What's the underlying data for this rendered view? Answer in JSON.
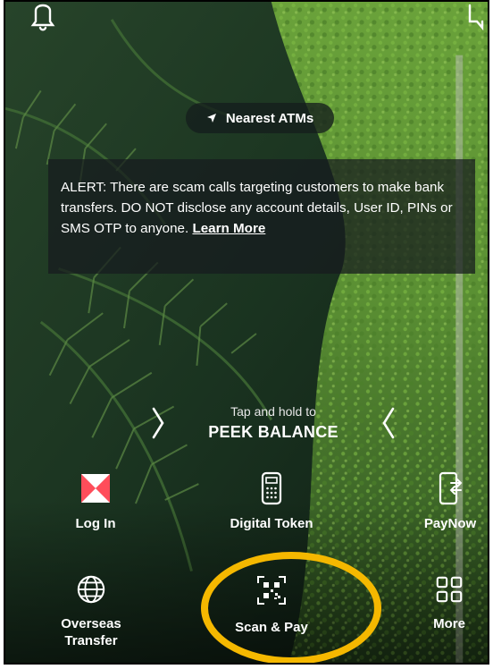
{
  "header": {
    "notifications_icon": "bell-icon",
    "chat_icon": "chat-icon"
  },
  "atm": {
    "label": "Nearest ATMs",
    "icon": "location-arrow-icon"
  },
  "alert": {
    "text": "ALERT: There are scam calls targeting customers to make bank transfers. DO NOT disclose any account details, User ID, PINs or SMS OTP to anyone. ",
    "link_label": "Learn More"
  },
  "peek": {
    "hint": "Tap and hold to",
    "title": "PEEK BALANCE"
  },
  "actions": [
    {
      "label": "Log In",
      "icon": "bank-logo-icon"
    },
    {
      "label": "Digital Token",
      "icon": "digital-token-icon"
    },
    {
      "label": "PayNow",
      "icon": "paynow-icon"
    },
    {
      "label": "Overseas Transfer",
      "icon": "globe-icon"
    },
    {
      "label": "Scan & Pay",
      "icon": "qr-scan-icon"
    },
    {
      "label": "More",
      "icon": "grid-icon"
    }
  ],
  "colors": {
    "highlight": "#F5B800",
    "logo_red": "#DB0011",
    "foliage_dark": "#14261a",
    "foliage_light": "#5f9a3a"
  }
}
